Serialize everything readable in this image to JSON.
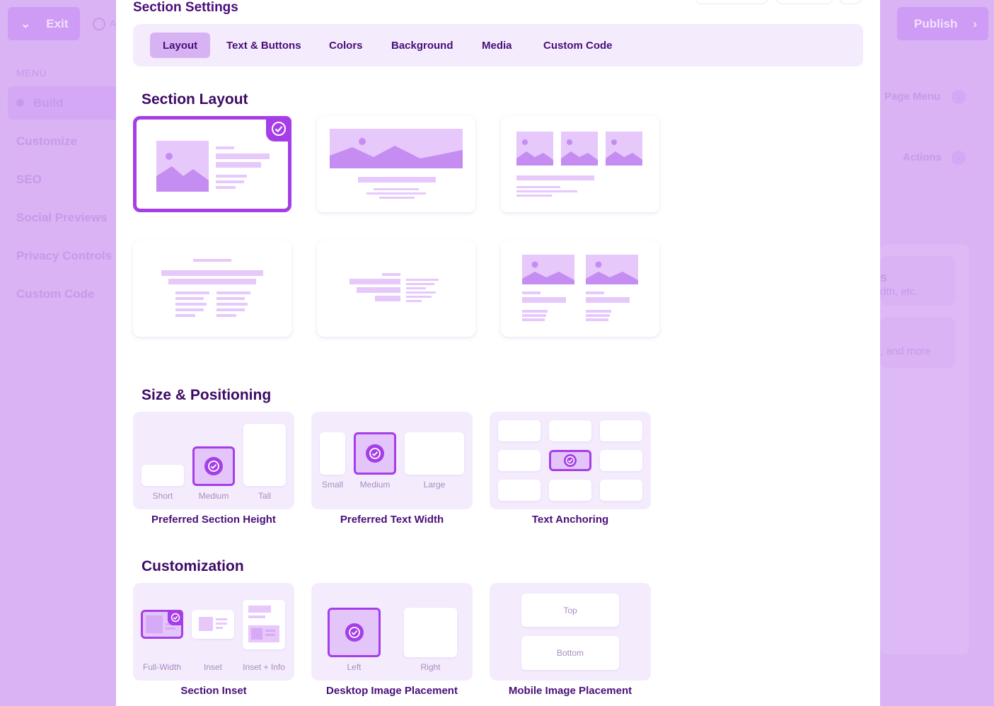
{
  "background_app": {
    "exit_label": "Exit",
    "publish_label": "Publish",
    "autosave_partial": "A",
    "menu_heading": "MENU",
    "menu_items": [
      "Build",
      "Customize",
      "SEO",
      "Social Previews",
      "Privacy Controls",
      "Custom Code"
    ],
    "page_menu_label": "Page Menu",
    "actions_label": "Actions",
    "card1_partial_title": "s",
    "card1_partial_sub": "dth, etc.",
    "card2_partial_sub": ", and more"
  },
  "modal": {
    "title": "Section Settings",
    "tabs": [
      {
        "label": "Layout",
        "active": true
      },
      {
        "label": "Text & Buttons",
        "active": false
      },
      {
        "label": "Colors",
        "active": false
      },
      {
        "label": "Background",
        "active": false
      },
      {
        "label": "Media",
        "active": false
      },
      {
        "label": "Custom Code",
        "active": false
      }
    ],
    "section_layout": {
      "heading": "Section Layout",
      "selected_index": 0
    },
    "size_positioning": {
      "heading": "Size & Positioning",
      "height": {
        "label": "Preferred Section Height",
        "options": [
          "Short",
          "Medium",
          "Tall"
        ],
        "selected": "Medium"
      },
      "width": {
        "label": "Preferred Text Width",
        "options": [
          "Small",
          "Medium",
          "Large"
        ],
        "selected": "Medium"
      },
      "anchoring": {
        "label": "Text Anchoring",
        "selected_cell": "center"
      }
    },
    "customization": {
      "heading": "Customization",
      "inset": {
        "label": "Section Inset",
        "options": [
          "Full-Width",
          "Inset",
          "Inset + Info"
        ],
        "selected": "Full-Width"
      },
      "desktop_image": {
        "label": "Desktop Image Placement",
        "options": [
          "Left",
          "Right"
        ],
        "selected": "Left"
      },
      "mobile_image": {
        "label": "Mobile Image Placement",
        "options": [
          "Top",
          "Bottom"
        ]
      }
    }
  },
  "colors": {
    "accent": "#a63ee8",
    "heading": "#3d0a66",
    "panel": "#f4ecfd",
    "overlay": "#d9b3f4"
  }
}
